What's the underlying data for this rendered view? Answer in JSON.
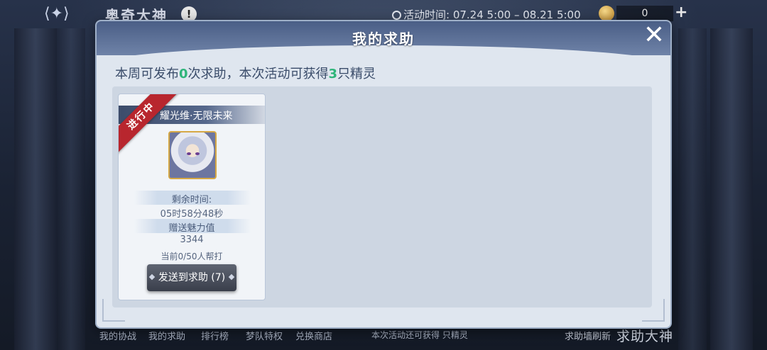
{
  "hud": {
    "event_title": "奥奇大神",
    "info_icon": "!",
    "activity_time": "活动时间: 07.24 5:00 – 08.21 5:00",
    "currency_count": "0",
    "plus_label": "+"
  },
  "dialog": {
    "title": "我的求助",
    "close_label": "✕",
    "subtitle_pre": "本周可发布",
    "subtitle_num1": "0",
    "subtitle_mid": "次求助，本次活动可获得",
    "subtitle_num2": "3",
    "subtitle_post": "只精灵"
  },
  "card": {
    "status_ribbon": "进行中",
    "name": "耀光维·无限未来",
    "remaining_label": "剩余时间:",
    "remaining_value": "05时58分48秒",
    "charm_label": "赠送魅力值",
    "charm_value": "3344",
    "helpers": "当前0/50人帮打",
    "send_button": "发送到求助 (7)"
  },
  "bottom_tabs": [
    "我的协战",
    "我的求助",
    "排行榜",
    "梦队特权",
    "兑换商店"
  ],
  "bottom_note": "本次活动还可获得 只精灵",
  "bottom_refresh": "求助墙刷新",
  "bottom_title": "求助大神",
  "colors": {
    "accent_green": "#2fb57a",
    "ribbon_red": "#b8262e",
    "header_blue": "#4a5e86"
  }
}
